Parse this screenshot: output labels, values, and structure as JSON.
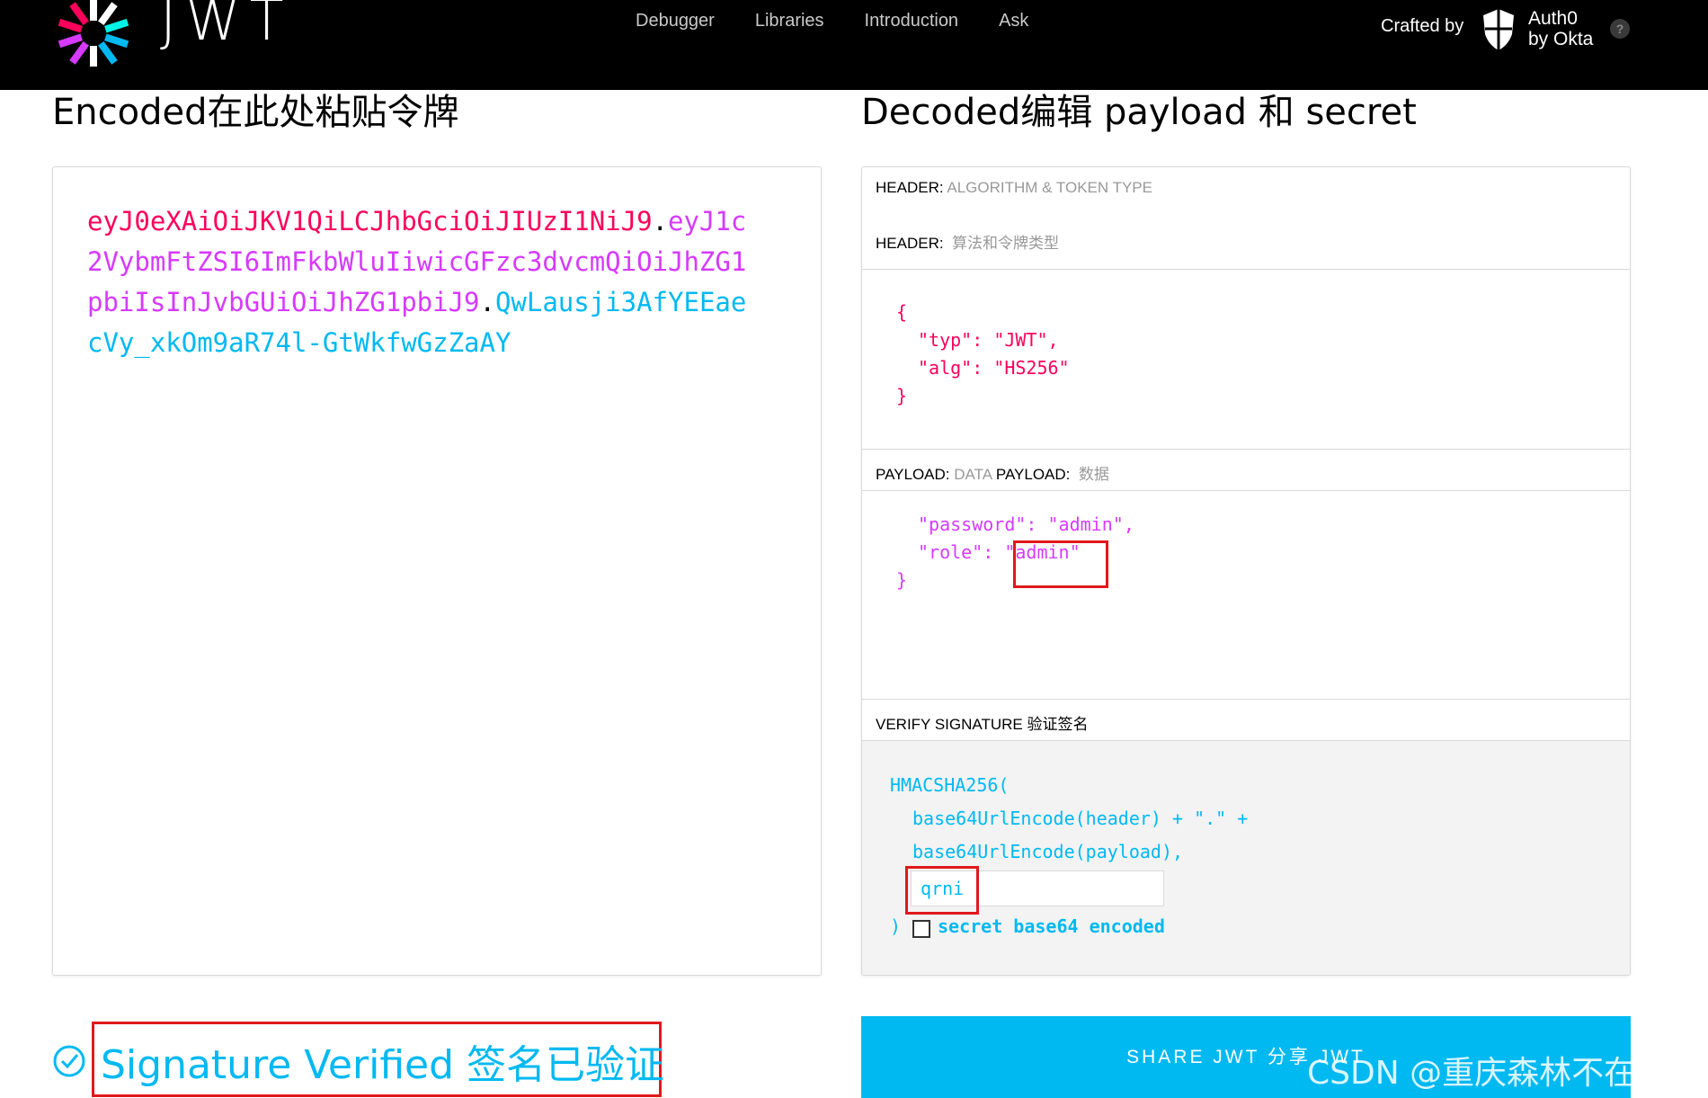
{
  "nav": {
    "logo_text": "JWT",
    "links": [
      "Debugger",
      "Libraries",
      "Introduction",
      "Ask"
    ],
    "crafted_by": "Crafted by",
    "brand_line1": "Auth0",
    "brand_line2": "by Okta",
    "help": "?"
  },
  "encoded": {
    "title": "Encoded在此处粘贴令牌",
    "token_header": "eyJ0eXAiOiJKV1QiLCJhbGciOiJIUzI1NiJ9",
    "dot": ".",
    "token_payload": "eyJ1c2VybmFtZSI6ImFkbWluIiwicGFzc3dvcmQiOiJhZG1pbiIsInJvbGUiOiJhZG1pbiJ9",
    "token_signature": "QwLausji3AfYEEaecVy_xkOm9aR74l-GtWkfwGzZaAY"
  },
  "decoded": {
    "title": "Decoded编辑 payload 和 secret",
    "header_label": "HEADER:",
    "header_sub": "ALGORITHM & TOKEN TYPE",
    "header_label2": "HEADER:",
    "header_sub2": "算法和令牌类型",
    "header_json": {
      "open": "{",
      "typ_key": "\"typ\"",
      "typ_val": "\"JWT\"",
      "alg_key": "\"alg\"",
      "alg_val": "\"HS256\"",
      "close": "}"
    },
    "payload_label": "PAYLOAD:",
    "payload_sub": "DATA",
    "payload_label2": "PAYLOAD:",
    "payload_sub2": "数据",
    "payload_json": {
      "password_key": "\"password\"",
      "password_val": "\"admin\"",
      "role_key": "\"role\"",
      "role_val": "\"admin\"",
      "close": "}"
    },
    "verify_label": "VERIFY SIGNATURE 验证签名",
    "verify_code": {
      "line1": "HMACSHA256(",
      "line2": "base64UrlEncode(header) + \".\" +",
      "line3": "base64UrlEncode(payload),",
      "close": ")"
    },
    "secret_value": "qrni",
    "checkbox_label": "secret base64 encoded",
    "checkbox_checked": false
  },
  "status": {
    "text": "Signature Verified 签名已验证"
  },
  "share_button": "SHARE JWT 分享 JWT",
  "watermark": "CSDN @重庆森林不在重庆",
  "colors": {
    "header_red": "#fb015b",
    "payload_purple": "#d63aff",
    "signature_blue": "#00b9f1",
    "highlight_red": "#e0191b"
  }
}
